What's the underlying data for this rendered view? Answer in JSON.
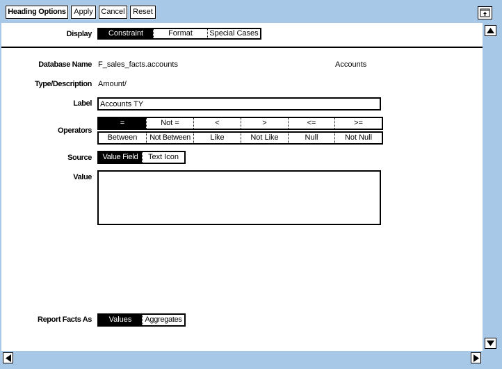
{
  "toolbar": {
    "heading_options": "Heading Options",
    "apply": "Apply",
    "cancel": "Cancel",
    "reset": "Reset",
    "restore_icon": "window-restore-icon"
  },
  "display": {
    "label": "Display",
    "tabs": [
      "Constraint",
      "Format",
      "Special Cases"
    ],
    "selected": "Constraint"
  },
  "database_name": {
    "label": "Database Name",
    "value": "F_sales_facts.accounts",
    "alias": "Accounts"
  },
  "type_description": {
    "label": "Type/Description",
    "value": "Amount/"
  },
  "label_field": {
    "label": "Label",
    "value": "Accounts TY"
  },
  "operators": {
    "label": "Operators",
    "row1": [
      "=",
      "Not =",
      "<",
      ">",
      "<=",
      ">="
    ],
    "row2": [
      "Between",
      "Not Between",
      "Like",
      "Not Like",
      "Null",
      "Not Null"
    ],
    "selected": "="
  },
  "source": {
    "label": "Source",
    "options": [
      "Value Field",
      "Text Icon"
    ],
    "selected": "Value Field"
  },
  "value_field": {
    "label": "Value",
    "value": ""
  },
  "report_facts": {
    "label": "Report Facts As",
    "options": [
      "Values",
      "Aggregates"
    ],
    "selected": "Values"
  },
  "scrollbars": {
    "up_icon": "triangle-up-icon",
    "down_icon": "triangle-down-icon",
    "left_icon": "triangle-left-icon",
    "right_icon": "triangle-right-icon"
  },
  "colors": {
    "chrome": "#a8c8e8",
    "panel": "#ffffff",
    "selected": "#000000"
  }
}
